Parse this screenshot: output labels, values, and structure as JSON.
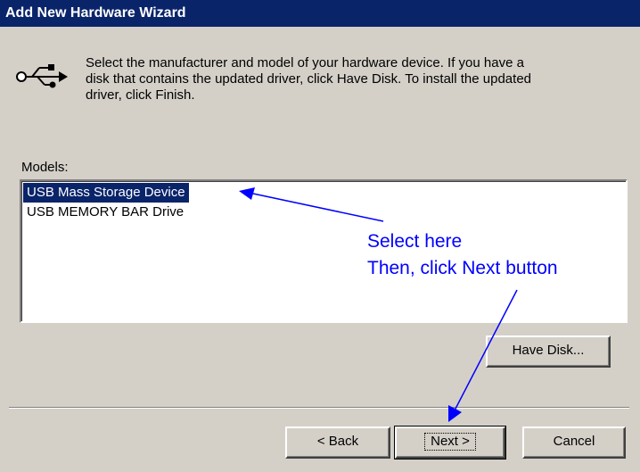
{
  "window": {
    "title": "Add New Hardware Wizard"
  },
  "icon": "usb-icon",
  "intro": {
    "line1": "Select the manufacturer and model of your hardware device. If you have a",
    "line2": "disk that contains the updated driver, click Have Disk. To install the updated",
    "line3": "driver, click Finish."
  },
  "models": {
    "label": "Models:",
    "items": [
      {
        "label": "USB Mass Storage Device",
        "selected": true
      },
      {
        "label": "USB MEMORY BAR Drive",
        "selected": false
      }
    ]
  },
  "buttons": {
    "have_disk": "Have Disk...",
    "back": "< Back",
    "next": "Next >",
    "cancel": "Cancel"
  },
  "annotation": {
    "line1": "Select here",
    "line2": "Then, click Next button",
    "color": "#0000ff"
  },
  "colors": {
    "title_bar": "#0a246a",
    "selection": "#0a246a",
    "face": "#d4d0c8"
  }
}
